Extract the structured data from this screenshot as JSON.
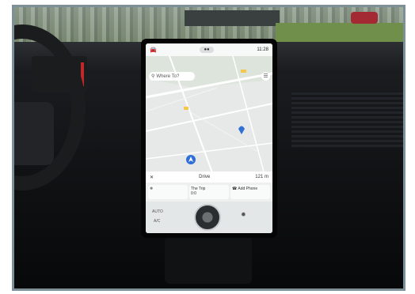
{
  "screen": {
    "clock": "11:28",
    "search_placeholder": "Where To?",
    "route_mode": "Drive",
    "range": "121 m",
    "trip_card_title": "The Trip",
    "trip_card_line2": "0:0",
    "phone_card": "Add Phone",
    "climate_auto": "AUTO",
    "climate_ac": "A/C"
  },
  "icons": [
    "car-icon",
    "search-icon",
    "navigation-arrow-icon",
    "phone-icon",
    "fan-icon"
  ]
}
